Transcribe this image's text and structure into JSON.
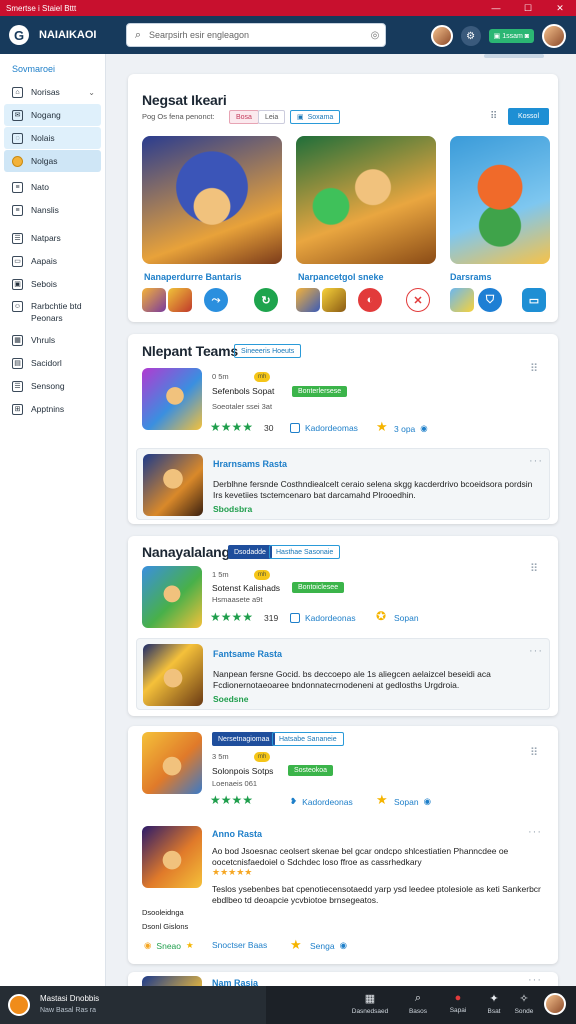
{
  "titlebar": {
    "title": "Smertse i Staiel Bttt",
    "min": "—",
    "max": "☐",
    "close": "✕"
  },
  "header": {
    "logo_char": "G",
    "brand": "NAIAIKAOI",
    "search_placeholder": "Searpsirh esir engleagon",
    "pill_label": "▣ 1ssam ◙"
  },
  "sidebar": {
    "heading": "Sovmaroei",
    "items": [
      {
        "label": "Norisas",
        "icon": "home-icon"
      },
      {
        "label": "Nogang",
        "icon": "mail-icon"
      },
      {
        "label": "Nolais",
        "icon": "chat-icon"
      },
      {
        "label": "Nolgas",
        "icon": "coin-icon"
      },
      {
        "label": "Nato",
        "icon": "doc-icon"
      },
      {
        "label": "Nanslis",
        "icon": "doc-icon"
      },
      {
        "label": "Natpars",
        "icon": "list-icon"
      },
      {
        "label": "Aapais",
        "icon": "folder-icon"
      },
      {
        "label": "Sebois",
        "icon": "box-icon"
      },
      {
        "label": "Rarbchtie btd Peonars",
        "icon": "user-icon"
      },
      {
        "label": "Vhruls",
        "icon": "grid-icon"
      },
      {
        "label": "Sacidorl",
        "icon": "card-icon"
      },
      {
        "label": "Sensong",
        "icon": "list-icon"
      },
      {
        "label": "Apptnins",
        "icon": "ruler-icon"
      }
    ]
  },
  "featured": {
    "title": "Negsat Ikeari",
    "subtitle": "Pog Os fena penonct:",
    "filter_a": "Bosa",
    "filter_b": "Leia",
    "filter_btn": "Soxama",
    "action_btn": "Kossol",
    "games": [
      {
        "title": "Nanaperdurre Bantaris"
      },
      {
        "title": "Narpancetgol sneke"
      },
      {
        "title": "Darsrams"
      }
    ]
  },
  "section1": {
    "title": "Nlepant Teams",
    "tag": "Sineeeris Hoeuts",
    "row": {
      "meta": "0 5m",
      "meta_badge": "mh",
      "name": "Sefenbols Sopat",
      "badge": "Bonterlersese",
      "sub": "Soeotaler ssei 3at",
      "rating": "★★★★",
      "count": "30",
      "link": "Kadordeomas",
      "stat": "3 opa"
    },
    "featured": {
      "title": "Hrarnsams Rasta",
      "desc": "Derblhne fersnde Costhndiealcelt ceraio selena skgg kacderdrivo bcoeidsora pordsin Irs kevetiies tsctemcenaro bat darcamahd Plrooedhin.",
      "action": "Sbodsbra"
    }
  },
  "section2": {
    "title": "Nanayalalangar",
    "tag_a": "Dsodadde",
    "tag_b": "Hasthae Sasonaie",
    "row": {
      "meta": "1 5m",
      "meta_badge": "mh",
      "name": "Sotenst Kalishads",
      "badge": "Bontoiclesee",
      "sub": "Hsmaasete a9t",
      "rating": "★★★★",
      "count": "319",
      "link": "Kadordeonas",
      "stat": "Sopan"
    },
    "featured": {
      "title": "Fantsame Rasta",
      "desc": "Nanpean fersne Gocid. bs deccoepo ale 1s aliegcen aelaizcel beseidi aca Fcdionernotaeoaree bndonnatecrnodeneni at gedlosths Urgdroia.",
      "action": "Soedsne"
    }
  },
  "section3": {
    "tag_a": "Nersetnagiomaa",
    "tag_b": "Hatsabe Sananeie",
    "row": {
      "meta": "3 5m",
      "meta_badge": "mh",
      "name": "Solonpois Sotps",
      "badge": "Sosteokoa",
      "sub": "Loenaeis 061",
      "rating": "★★★★",
      "count": "",
      "link": "Kadordeonas",
      "stat": "Sopan"
    },
    "featured": {
      "title": "Anno Rasta",
      "desc": "Ao bod Jsoesnac ceolsert skenae bel gcar ondcpo shlcestiatien Phanncdee oe oocetcnisfaedoiel o Sdchdec loso ffroe as cassrhedkary",
      "desc2": "Teslos ysebenbes bat cpenotiecensotaedd yarp ysd leedee ptolesiole as keti Sankerbcr ebdlbeo td deoapcie ycvbiotoe brnsegeatos.",
      "rating": "★★★★★",
      "left_a": "Dsooleidnga",
      "left_b": "Dsonl Gislons",
      "foot_1": "Sneao",
      "foot_2": "Snoctser Baas",
      "foot_3": "Senga"
    }
  },
  "section4": {
    "title": "Nam Rasia"
  },
  "bottombar": {
    "title": "Mastasi Dnobbis",
    "sub": "Naw Basal Ras ra",
    "items": [
      {
        "label": "Dasnedsaed",
        "icon": "news-icon",
        "glyph": "▦"
      },
      {
        "label": "Basos",
        "icon": "search-icon",
        "glyph": "⌕"
      },
      {
        "label": "Sapai",
        "icon": "alert-icon",
        "glyph": "●"
      },
      {
        "label": "Bsat",
        "icon": "star-icon",
        "glyph": "✦"
      },
      {
        "label": "Sonde",
        "icon": "flag-icon",
        "glyph": "✧"
      }
    ]
  }
}
